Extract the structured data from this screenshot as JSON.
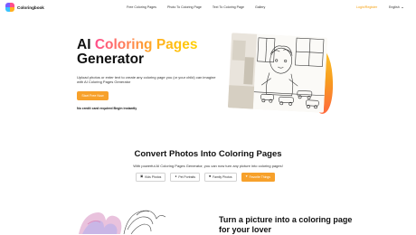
{
  "header": {
    "brand": "Coloringbook",
    "nav": [
      "Free Coloring Pages",
      "Photo To Coloring Page",
      "Text To Coloring Page",
      "Gallery"
    ],
    "login": "Login/Register",
    "language": "English"
  },
  "hero": {
    "title_part1": "AI ",
    "title_highlight": "Coloring Pages",
    "title_part2": " Generator",
    "description": "Upload photos or enter text to create any coloring page you (or your child) can imagine with AI Coloring Pages Generator",
    "cta": "Start Free Now",
    "note": "No credit card required Begin instantly"
  },
  "convert": {
    "title": "Convert Photos Into Coloring Pages",
    "description": "With powerful AI Coloring Pages Generator, you can now turn any picture into coloring pages!",
    "tabs": [
      {
        "label": "Kids Photos",
        "icon": "image-icon",
        "active": false
      },
      {
        "label": "Pet Portraits",
        "icon": "paw-icon",
        "active": false
      },
      {
        "label": "Family Photos",
        "icon": "camera-icon",
        "active": false
      },
      {
        "label": "Favorite Things",
        "icon": "heart-icon",
        "active": true
      }
    ]
  },
  "lover": {
    "title": "Turn a picture into a coloring page for your lover"
  },
  "colors": {
    "accent": "#f7a12b",
    "highlight_gradient": [
      "#ff4d8b",
      "#ffb020",
      "#ffd000"
    ]
  }
}
